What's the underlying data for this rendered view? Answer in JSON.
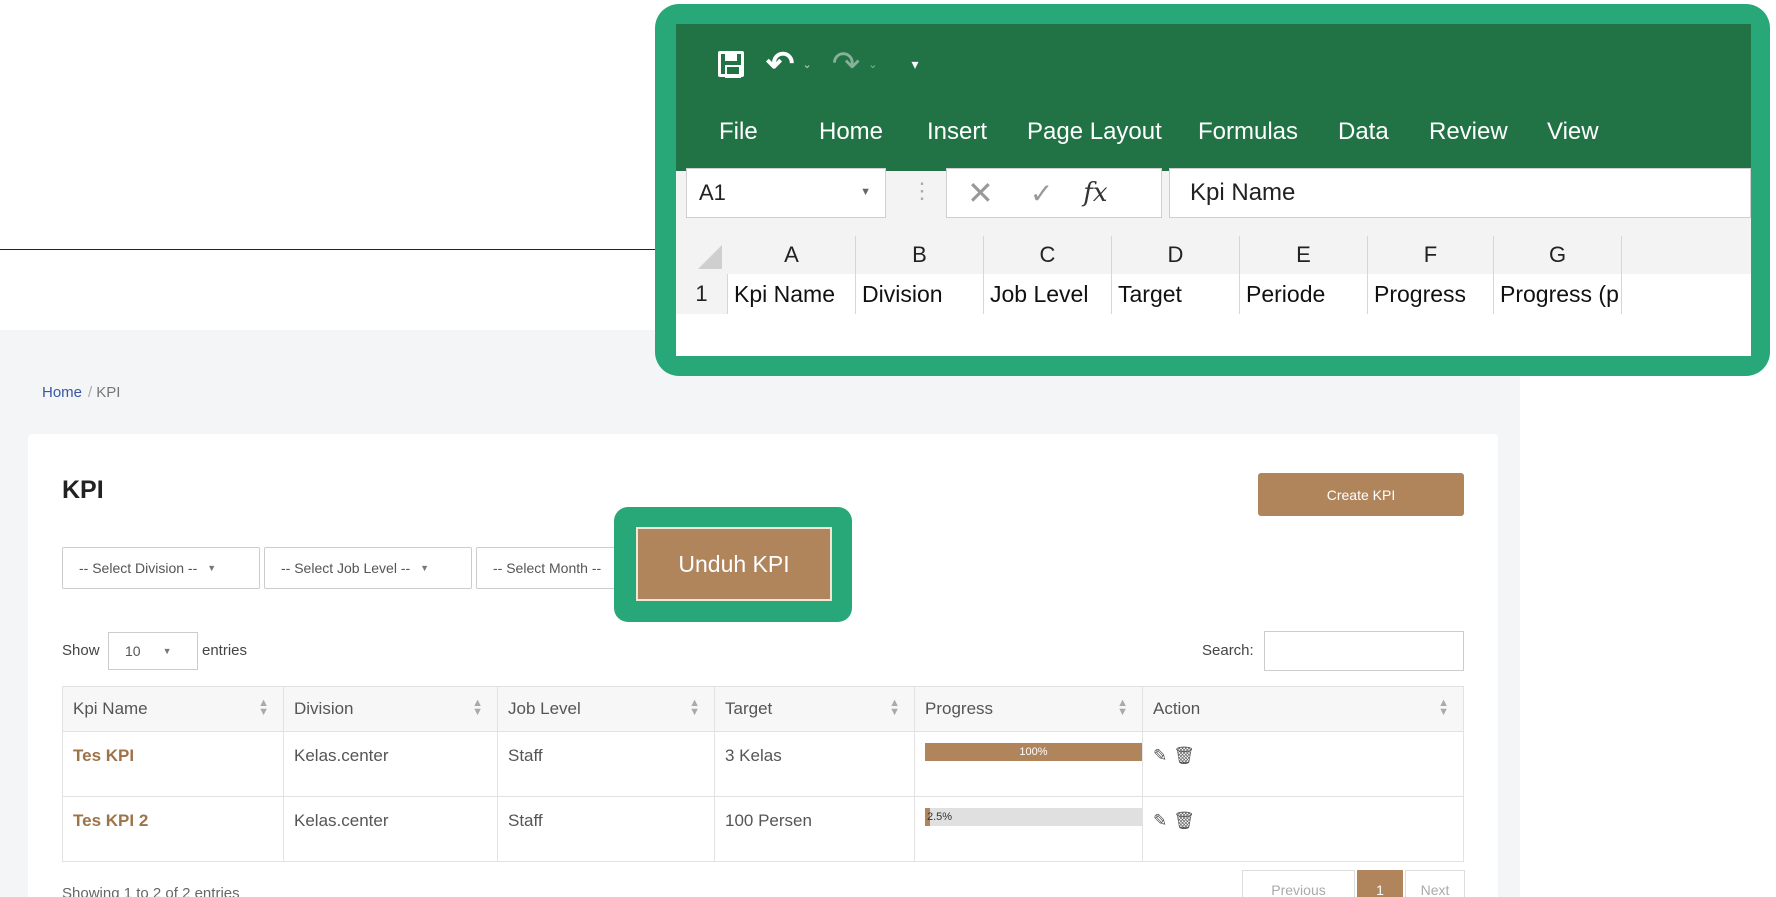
{
  "breadcrumb": {
    "home": "Home",
    "separator": "/",
    "current": "KPI"
  },
  "page": {
    "title": "KPI",
    "create_button": "Create KPI",
    "download_button": "Unduh KPI"
  },
  "filters": {
    "division": "-- Select Division --",
    "job_level": "-- Select Job Level --",
    "month": "-- Select Month --"
  },
  "length": {
    "show": "Show",
    "value": "10",
    "entries": "entries"
  },
  "search": {
    "label": "Search:",
    "value": ""
  },
  "table": {
    "columns": [
      "Kpi Name",
      "Division",
      "Job Level",
      "Target",
      "Progress",
      "Action"
    ],
    "rows": [
      {
        "name": "Tes KPI",
        "division": "Kelas.center",
        "job_level": "Staff",
        "target": "3 Kelas",
        "progress": 100,
        "progress_label": "100%"
      },
      {
        "name": "Tes KPI 2",
        "division": "Kelas.center",
        "job_level": "Staff",
        "target": "100 Persen",
        "progress": 2.5,
        "progress_label": "2.5%"
      }
    ]
  },
  "footer": {
    "info": "Showing 1 to 2 of 2 entries",
    "prev": "Previous",
    "page": "1",
    "next": "Next"
  },
  "excel": {
    "menu": [
      "File",
      "Home",
      "Insert",
      "Page Layout",
      "Formulas",
      "Data",
      "Review",
      "View"
    ],
    "name_box": "A1",
    "formula": "Kpi Name",
    "fx": "fx",
    "columns": [
      "A",
      "B",
      "C",
      "D",
      "E",
      "F",
      "G"
    ],
    "row_number": "1",
    "cells": [
      "Kpi Name",
      "Division",
      "Job Level",
      "Target",
      "Periode",
      "Progress",
      "Progress (p"
    ]
  },
  "colors": {
    "accent": "#b0855c",
    "highlight": "#28a878",
    "excel_green": "#217346"
  },
  "icons": [
    "save-icon",
    "undo-icon",
    "redo-icon",
    "customize-qat-icon",
    "cancel-icon",
    "enter-icon",
    "function-icon",
    "edit-icon",
    "delete-icon",
    "sort-icon"
  ]
}
